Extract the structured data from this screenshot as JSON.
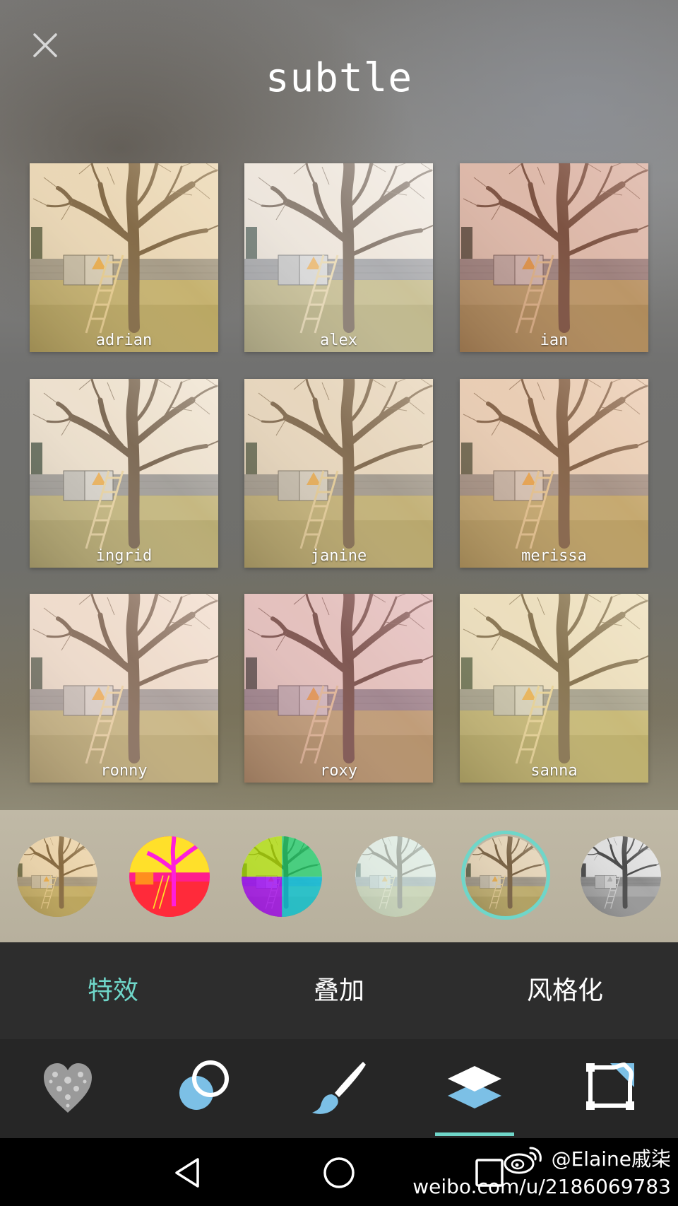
{
  "header": {
    "title": "subtle"
  },
  "filters": [
    {
      "name": "adrian",
      "tint": "rgba(240,200,120,0.28)"
    },
    {
      "name": "alex",
      "tint": "rgba(255,255,255,0.30)"
    },
    {
      "name": "ian",
      "tint": "rgba(200,110,90,0.32)"
    },
    {
      "name": "ingrid",
      "tint": "rgba(255,235,200,0.22)"
    },
    {
      "name": "janine",
      "tint": "rgba(230,200,150,0.30)"
    },
    {
      "name": "merissa",
      "tint": "rgba(235,170,120,0.30)"
    },
    {
      "name": "ronny",
      "tint": "rgba(255,220,200,0.30)"
    },
    {
      "name": "roxy",
      "tint": "rgba(220,130,150,0.30)"
    },
    {
      "name": "sanna",
      "tint": "rgba(245,225,150,0.30)"
    }
  ],
  "categories": {
    "selected_index": 4,
    "items": [
      {
        "name": "warm-thumb"
      },
      {
        "name": "pop-art-thumb"
      },
      {
        "name": "quad-color-thumb"
      },
      {
        "name": "fade-thumb"
      },
      {
        "name": "subtle-thumb"
      },
      {
        "name": "mono-thumb"
      }
    ]
  },
  "tabs": {
    "selected": 0,
    "items": [
      {
        "label": "特效"
      },
      {
        "label": "叠加"
      },
      {
        "label": "风格化"
      }
    ],
    "active_color": "#6fd6c9",
    "inactive_color": "#ffffff"
  },
  "toolbar": {
    "selected": 3,
    "items": [
      {
        "icon": "lace-heart-icon"
      },
      {
        "icon": "circles-icon"
      },
      {
        "icon": "brush-icon"
      },
      {
        "icon": "layers-icon"
      },
      {
        "icon": "crop-icon"
      }
    ]
  },
  "watermark": {
    "user": "@Elaine戚柒",
    "url": "weibo.com/u/2186069783"
  },
  "colors": {
    "accent": "#6fd6c9",
    "tool_blue": "#7cc0e6"
  }
}
